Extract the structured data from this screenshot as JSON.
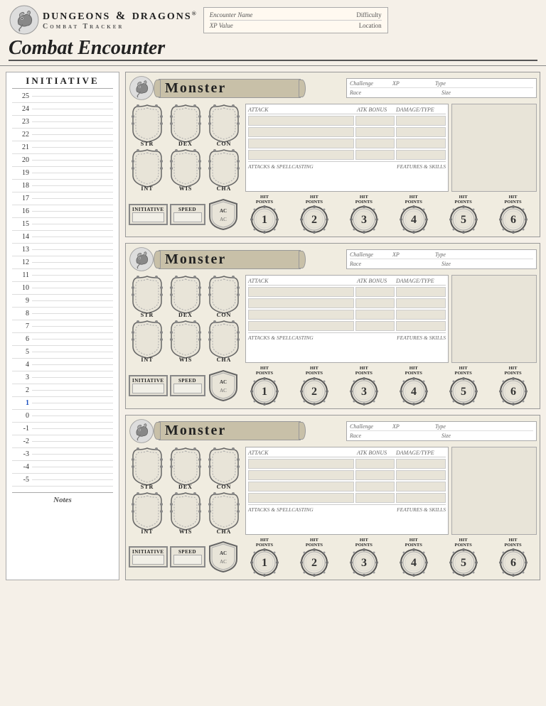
{
  "header": {
    "brand": "DUNGEONS",
    "and": "&",
    "dragons": "DRAGONS",
    "registered": "®",
    "subtitle": "Combat Tracker",
    "title": "Combat Encounter",
    "encounter_name_label": "Encounter Name",
    "difficulty_label": "Difficulty",
    "xp_value_label": "XP Value",
    "location_label": "Location"
  },
  "initiative": {
    "title": "INITIATIVE",
    "numbers": [
      25,
      24,
      23,
      22,
      21,
      20,
      19,
      18,
      17,
      16,
      15,
      14,
      13,
      12,
      11,
      10,
      9,
      8,
      7,
      6,
      5,
      4,
      3,
      2,
      1,
      0,
      -1,
      -2,
      -3,
      -4,
      -5
    ],
    "notes_label": "Notes"
  },
  "monsters": [
    {
      "title": "Monster",
      "challenge_label": "Challenge",
      "xp_label": "XP",
      "type_label": "Type",
      "race_label": "Race",
      "size_label": "Size",
      "stats": [
        "STR",
        "DEX",
        "CON",
        "INT",
        "WIS",
        "CHA"
      ],
      "attack_label": "ATTACK",
      "atk_bonus_label": "ATK BONUS",
      "damage_type_label": "DAMAGE/TYPE",
      "attacks_spellcasting_label": "ATTACKS & SPELLCASTING",
      "features_skills_label": "FEATURES & SKILLS",
      "initiative_label": "INITIATIVE",
      "speed_label": "SPEED",
      "ac_label": "AC",
      "hit_points_label": "HIT POINTS",
      "hp_numbers": [
        1,
        2,
        3,
        4,
        5,
        6
      ]
    },
    {
      "title": "Monster",
      "challenge_label": "Challenge",
      "xp_label": "XP",
      "type_label": "Type",
      "race_label": "Race",
      "size_label": "Size",
      "stats": [
        "STR",
        "DEX",
        "CON",
        "INT",
        "WIS",
        "CHA"
      ],
      "attack_label": "ATTACK",
      "atk_bonus_label": "ATK BONUS",
      "damage_type_label": "DAMAGE/TYPE",
      "attacks_spellcasting_label": "ATTACKS & SPELLCASTING",
      "features_skills_label": "FEATURES & SKILLS",
      "initiative_label": "INITIATIVE",
      "speed_label": "SPEED",
      "ac_label": "AC",
      "hit_points_label": "HIT POINTS",
      "hp_numbers": [
        1,
        2,
        3,
        4,
        5,
        6
      ]
    },
    {
      "title": "Monster",
      "challenge_label": "Challenge",
      "xp_label": "XP",
      "type_label": "Type",
      "race_label": "Race",
      "size_label": "Size",
      "stats": [
        "STR",
        "DEX",
        "CON",
        "INT",
        "WIS",
        "CHA"
      ],
      "attack_label": "ATTACK",
      "atk_bonus_label": "ATK BONUS",
      "damage_type_label": "DAMAGE/TYPE",
      "attacks_spellcasting_label": "ATTACKS & SPELLCASTING",
      "features_skills_label": "FEATURES & SKILLS",
      "initiative_label": "INITIATIVE",
      "speed_label": "SPEED",
      "ac_label": "AC",
      "hit_points_label": "HIT POINTS",
      "hp_numbers": [
        1,
        2,
        3,
        4,
        5,
        6
      ]
    }
  ]
}
